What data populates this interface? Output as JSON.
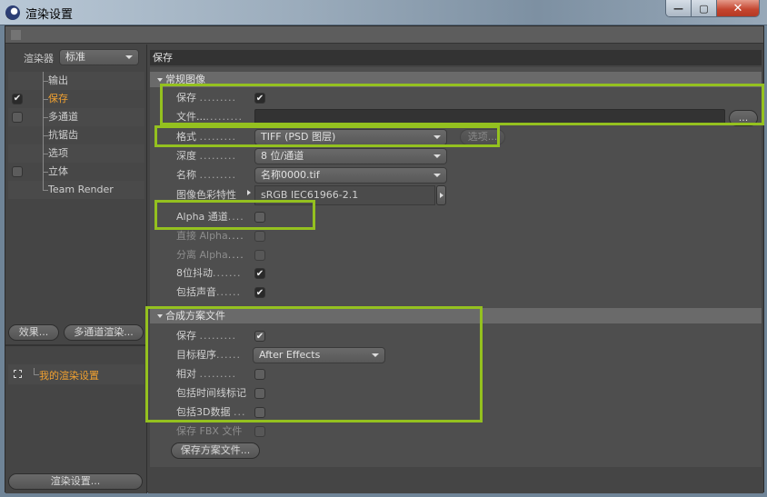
{
  "window": {
    "title": "渲染设置",
    "controls": {
      "minimize": "—",
      "maximize": "▢",
      "close": "✕"
    }
  },
  "left_panel": {
    "renderer_label": "渲染器",
    "renderer_value": "标准",
    "tree": [
      {
        "label": "输出",
        "checkbox": "none",
        "active": false
      },
      {
        "label": "保存",
        "checkbox": "checked",
        "active": true
      },
      {
        "label": "多通道",
        "checkbox": "unchecked",
        "active": false
      },
      {
        "label": "抗锯齿",
        "checkbox": "none",
        "active": false
      },
      {
        "label": "选项",
        "checkbox": "none",
        "active": false
      },
      {
        "label": "立体",
        "checkbox": "unchecked",
        "active": false
      },
      {
        "label": "Team Render",
        "checkbox": "none",
        "active": false
      }
    ],
    "effects_button": "效果...",
    "multipass_button": "多通道渲染...",
    "settings_item": "我的渲染设置",
    "render_settings_button": "渲染设置..."
  },
  "right_panel": {
    "header": "保存",
    "regular_image": {
      "title": "常规图像",
      "save_label": "保存",
      "save_checked": true,
      "file_label": "文件...",
      "file_value": "",
      "browse_button": "...",
      "format_label": "格式",
      "format_value": "TIFF (PSD 图层)",
      "options_button": "选项...",
      "depth_label": "深度",
      "depth_value": "8 位/通道",
      "name_label": "名称",
      "name_value": "名称0000.tif",
      "color_profile_label": "图像色彩特性",
      "color_profile_value": "sRGB IEC61966-2.1",
      "alpha_label": "Alpha 通道",
      "alpha_checked": false,
      "straight_alpha_label": "直接 Alpha",
      "straight_alpha_checked": false,
      "separate_alpha_label": "分离 Alpha",
      "separate_alpha_checked": false,
      "dither_label": "8位抖动",
      "dither_checked": true,
      "sound_label": "包括声音",
      "sound_checked": true
    },
    "compositing": {
      "title": "合成方案文件",
      "save_label": "保存",
      "save_checked": true,
      "target_label": "目标程序",
      "target_value": "After Effects",
      "relative_label": "相对",
      "relative_checked": false,
      "timeline_markers_label": "包括时间线标记",
      "timeline_markers_checked": false,
      "3d_data_label": "包括3D数据",
      "3d_data_checked": false,
      "fbx_label": "保存 FBX 文件",
      "fbx_checked": false,
      "save_project_button": "保存方案文件..."
    }
  },
  "highlight_color": "#94c11f",
  "active_color": "#f0a030",
  "check_glyph": "✔"
}
